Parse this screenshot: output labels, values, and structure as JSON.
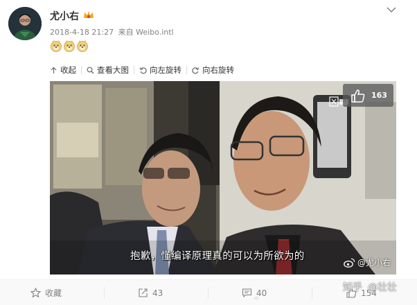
{
  "post": {
    "author": "尤小右",
    "date": "2018-4-18 21:27",
    "source_prefix": "来自",
    "source": "Weibo.intl",
    "emoji_count": 3
  },
  "toolbar": {
    "collapse": "收起",
    "view_large": "查看大图",
    "rotate_left": "向左旋转",
    "rotate_right": "向右旋转"
  },
  "photo": {
    "likes": "163",
    "subtitle": "抱歉，懂编译原理真的可以为所欲为的",
    "watermark": "@尤小右"
  },
  "actions": {
    "favorite": "收藏",
    "repost_count": "43",
    "comment_count": "40",
    "like_count": "154"
  },
  "watermark": {
    "site": "知乎",
    "user": "@壮壮"
  },
  "colors": {
    "link": "#eb7350",
    "meta_gray": "#808080",
    "bar_bg": "#f9f9f9"
  }
}
